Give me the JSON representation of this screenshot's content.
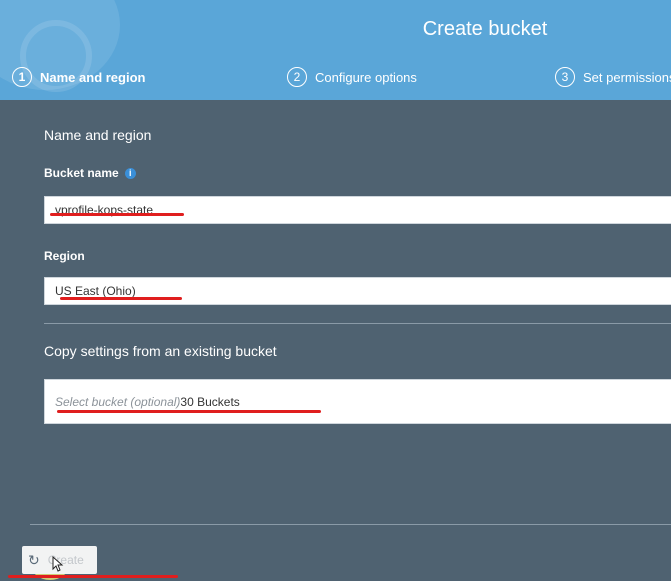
{
  "header": {
    "title": "Create bucket",
    "steps": [
      {
        "num": "1",
        "label": "Name and region",
        "active": true
      },
      {
        "num": "2",
        "label": "Configure options",
        "active": false
      },
      {
        "num": "3",
        "label": "Set permissions",
        "active": false
      }
    ]
  },
  "form": {
    "section_title": "Name and region",
    "bucket_name_label": "Bucket name",
    "bucket_name_value": "vprofile-kops-state",
    "region_label": "Region",
    "region_value": "US East (Ohio)",
    "copy_section_title": "Copy settings from an existing bucket",
    "copy_placeholder": "Select bucket (optional)",
    "copy_count": "30 Buckets"
  },
  "footer": {
    "create_label": "Create"
  },
  "colors": {
    "header_bg": "#5aa6d8",
    "page_bg": "#4f6271",
    "annotation_red": "#e01e1e",
    "highlight": "#f6f078"
  }
}
